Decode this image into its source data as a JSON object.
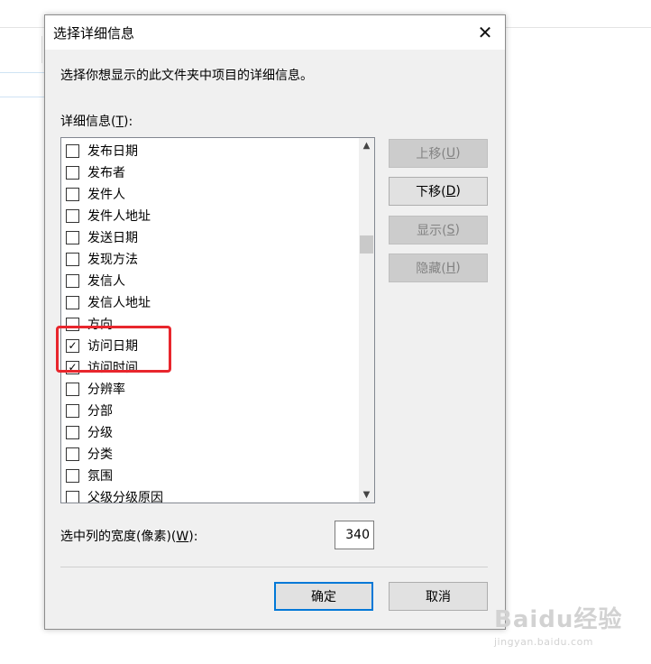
{
  "dialog": {
    "title": "选择详细信息",
    "close_icon": "close-icon",
    "instruction": "选择你想显示的此文件夹中项目的详细信息。",
    "list_label_prefix": "详细信息(",
    "list_label_key": "T",
    "list_label_suffix": "):",
    "items": [
      {
        "label": "发布日期",
        "checked": false
      },
      {
        "label": "发布者",
        "checked": false
      },
      {
        "label": "发件人",
        "checked": false
      },
      {
        "label": "发件人地址",
        "checked": false
      },
      {
        "label": "发送日期",
        "checked": false
      },
      {
        "label": "发现方法",
        "checked": false
      },
      {
        "label": "发信人",
        "checked": false
      },
      {
        "label": "发信人地址",
        "checked": false
      },
      {
        "label": "方向",
        "checked": false
      },
      {
        "label": "访问日期",
        "checked": true
      },
      {
        "label": "访问时间",
        "checked": true
      },
      {
        "label": "分辨率",
        "checked": false
      },
      {
        "label": "分部",
        "checked": false
      },
      {
        "label": "分级",
        "checked": false
      },
      {
        "label": "分类",
        "checked": false
      },
      {
        "label": "氛围",
        "checked": false
      },
      {
        "label": "父级分级原因",
        "checked": false
      }
    ],
    "buttons": {
      "move_up": {
        "label": "上移(",
        "key": "U",
        "suffix": ")",
        "enabled": false
      },
      "move_down": {
        "label": "下移(",
        "key": "D",
        "suffix": ")",
        "enabled": true
      },
      "show": {
        "label": "显示(",
        "key": "S",
        "suffix": ")",
        "enabled": false
      },
      "hide": {
        "label": "隐藏(",
        "key": "H",
        "suffix": ")",
        "enabled": false
      }
    },
    "width_label_prefix": "选中列的宽度(像素)(",
    "width_label_key": "W",
    "width_label_suffix": "):",
    "width_value": "340",
    "ok_label": "确定",
    "cancel_label": "取消"
  },
  "watermark": {
    "main": "Baidu经验",
    "sub": "jingyan.baidu.com"
  },
  "colors": {
    "highlight": "#e8262d",
    "focus": "#0078d7"
  }
}
